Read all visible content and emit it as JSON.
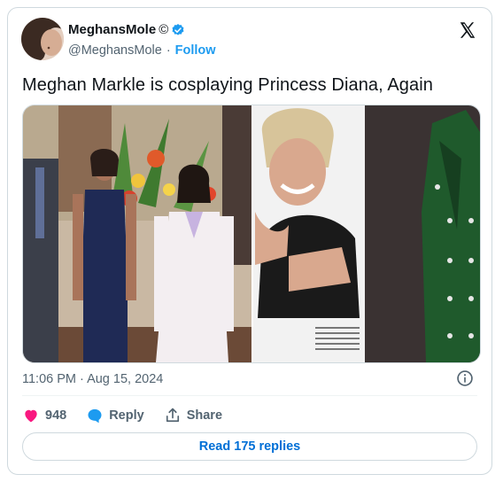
{
  "author": {
    "display_name": "MeghansMole",
    "copyright_symbol": "©",
    "handle": "@MeghansMole",
    "follow_label": "Follow"
  },
  "tweet": {
    "text": "Meghan Markle is cosplaying Princess Diana, Again",
    "timestamp": "11:06 PM · Aug 15, 2024"
  },
  "actions": {
    "likes": "948",
    "reply_label": "Reply",
    "share_label": "Share"
  },
  "read_replies_label": "Read 175 replies",
  "colors": {
    "like": "#f91880",
    "reply": "#1d9bf0",
    "link": "#006fd6",
    "muted": "#536471",
    "dress_green": "#1f5a2c"
  }
}
